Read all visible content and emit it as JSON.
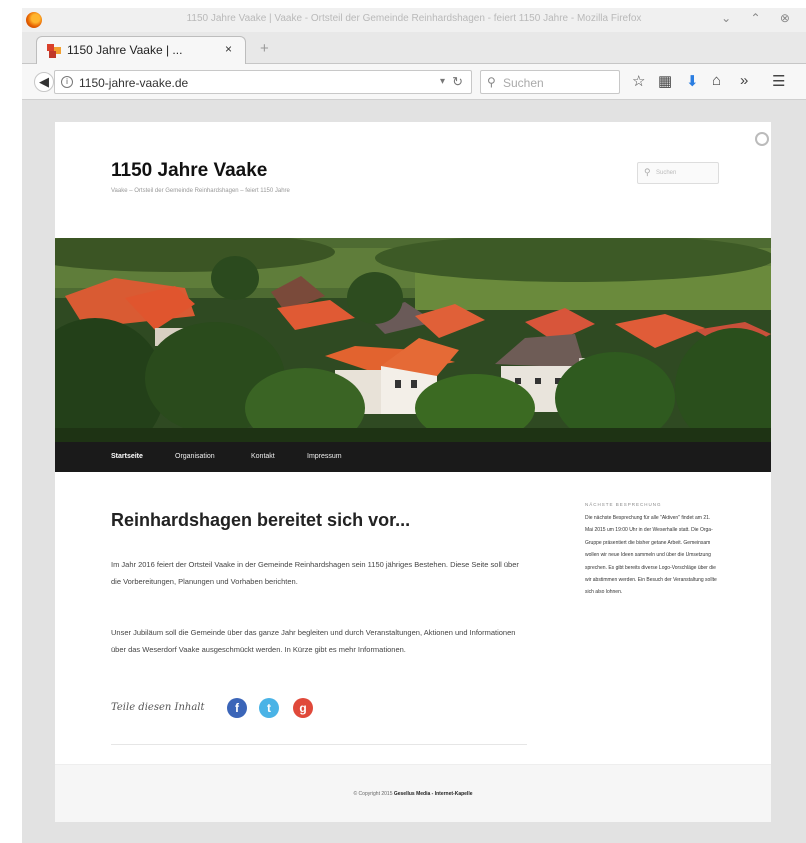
{
  "browser": {
    "window_title": "1150 Jahre Vaake | Vaake - Ortsteil der Gemeinde Reinhardshagen - feiert 1150 Jahre - Mozilla Firefox",
    "tab_label": "1150 Jahre Vaake | ...",
    "tab_close": "×",
    "new_tab": "+",
    "url": "1150-jahre-vaake.de",
    "search_placeholder": "Suchen",
    "window_controls": "⌄ ⌃ ⊗"
  },
  "site": {
    "title": "1150 Jahre Vaake",
    "description": "Vaake – Ortsteil der Gemeinde Reinhardshagen – feiert 1150 Jahre",
    "search_placeholder": "Suchen"
  },
  "nav": {
    "items": [
      {
        "label": "Startseite"
      },
      {
        "label": "Organisation"
      },
      {
        "label": "Kontakt"
      },
      {
        "label": "Impressum"
      }
    ]
  },
  "post": {
    "title": "Reinhardshagen bereitet sich vor...",
    "paragraph1": "Im Jahr 2016 feiert der Ortsteil Vaake in der Gemeinde Reinhardshagen sein 1150 jähriges Bestehen. Diese Seite soll über die Vorbereitungen, Planungen und Vorhaben berichten.",
    "paragraph2": "Unser Jubiläum soll die Gemeinde über das ganze Jahr begleiten und durch Veranstaltungen, Aktionen und Informationen über das Weserdorf Vaake ausgeschmückt werden. In Kürze gibt es mehr Informationen.",
    "share_label": "Teile diesen Inhalt"
  },
  "sidebar": {
    "widget_title": "Nächste Besprechung",
    "widget_text": "Die nächste Besprechung für alle \"Aktiven\" findet am 21. Mai 2015 um 19:00 Uhr in der Weserhalle statt. Die Orga-Gruppe präsentiert die bisher getane Arbeit. Gemeinsam wollen wir neue Ideen sammeln und über die Umsetzung sprechen. Es gibt bereits diverse Logo-Vorschläge über die wir abstimmen werden. Ein Besuch der Veranstaltung sollte sich also lohnen."
  },
  "footer": {
    "prefix": "© Copyright 2015",
    "company": "Gesellus Media - Internet-Kapelle"
  },
  "colors": {
    "nav_bg": "#1a1a1a",
    "page_bg": "#e2e2e2",
    "roof_red": "#e0552e",
    "facebook": "#3b65b8",
    "twitter": "#4ab3e6",
    "google": "#e0493a"
  }
}
